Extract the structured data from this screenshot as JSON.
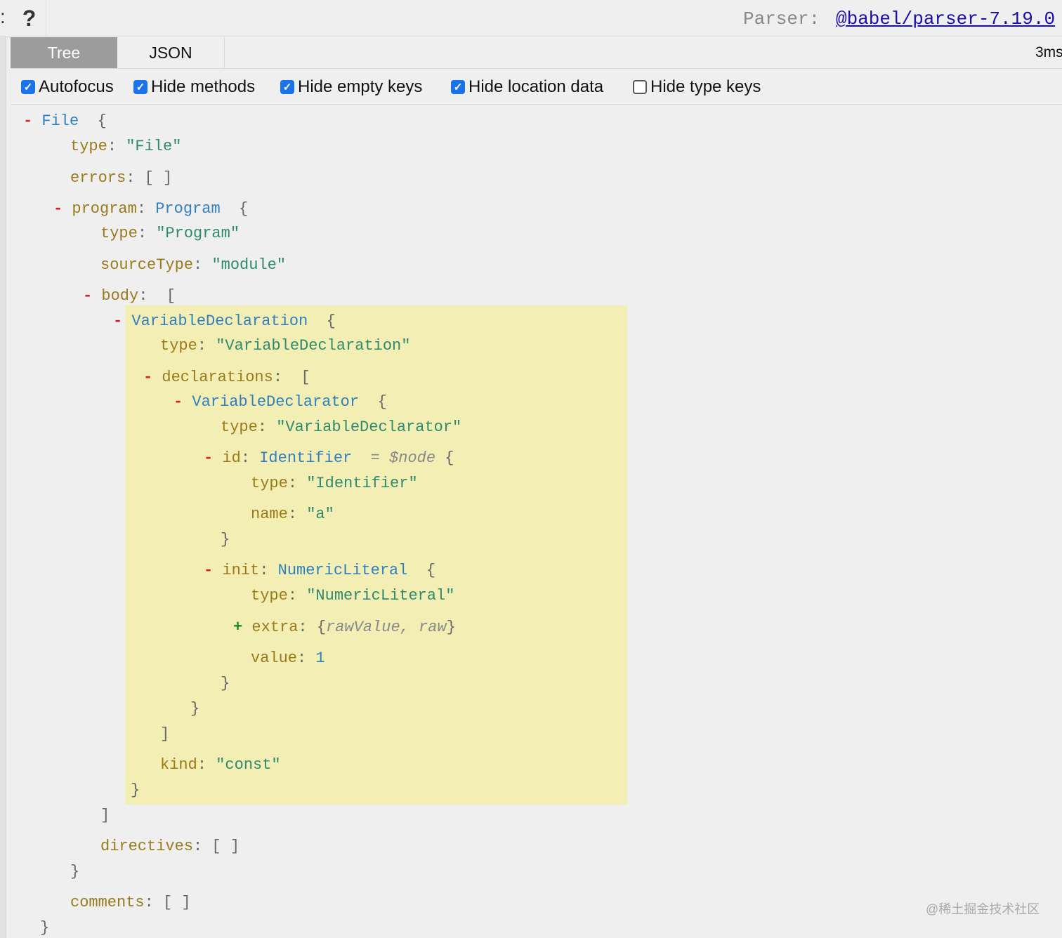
{
  "toolbar": {
    "left_glyph": ":",
    "help_label": "?",
    "parser_label": "Parser:",
    "parser_link": "@babel/parser-7.19.0"
  },
  "tabs": [
    {
      "label": "Tree",
      "active": true
    },
    {
      "label": "JSON",
      "active": false
    }
  ],
  "parse_time": "3ms",
  "options": [
    {
      "label": "Autofocus",
      "checked": true
    },
    {
      "label": "Hide methods",
      "checked": true
    },
    {
      "label": "Hide empty keys",
      "checked": true
    },
    {
      "label": "Hide location data",
      "checked": true
    },
    {
      "label": "Hide type keys",
      "checked": false
    }
  ],
  "tree": {
    "file_type": "File",
    "file_type_value": "\"File\"",
    "errors_key": "errors",
    "program_key": "program",
    "program_type": "Program",
    "program_type_value": "\"Program\"",
    "source_type_key": "sourceType",
    "source_type_value": "\"module\"",
    "body_key": "body",
    "var_decl_type": "VariableDeclaration",
    "var_decl_type_value": "\"VariableDeclaration\"",
    "declarations_key": "declarations",
    "declarator_type": "VariableDeclarator",
    "declarator_type_value": "\"VariableDeclarator\"",
    "id_key": "id",
    "identifier_type": "Identifier",
    "node_ref": "= $node",
    "identifier_type_value": "\"Identifier\"",
    "name_key": "name",
    "name_value": "\"a\"",
    "init_key": "init",
    "numeric_type": "NumericLiteral",
    "numeric_type_value": "\"NumericLiteral\"",
    "extra_key": "extra",
    "extra_summary": "rawValue, raw",
    "value_key": "value",
    "value_value": "1",
    "kind_key": "kind",
    "kind_value": "\"const\"",
    "directives_key": "directives",
    "comments_key": "comments",
    "type_key": "type"
  },
  "watermark": "@稀土掘金技术社区",
  "colors": {
    "accent": "#1a73e8",
    "active_tab": "#9c9c9c",
    "highlight": "#f3eeb4",
    "key": "#9a7a1a",
    "type_name": "#2f7fc1",
    "string": "#2e8a6e",
    "toggle_minus": "#d61f1f",
    "toggle_plus": "#1e8a30"
  }
}
